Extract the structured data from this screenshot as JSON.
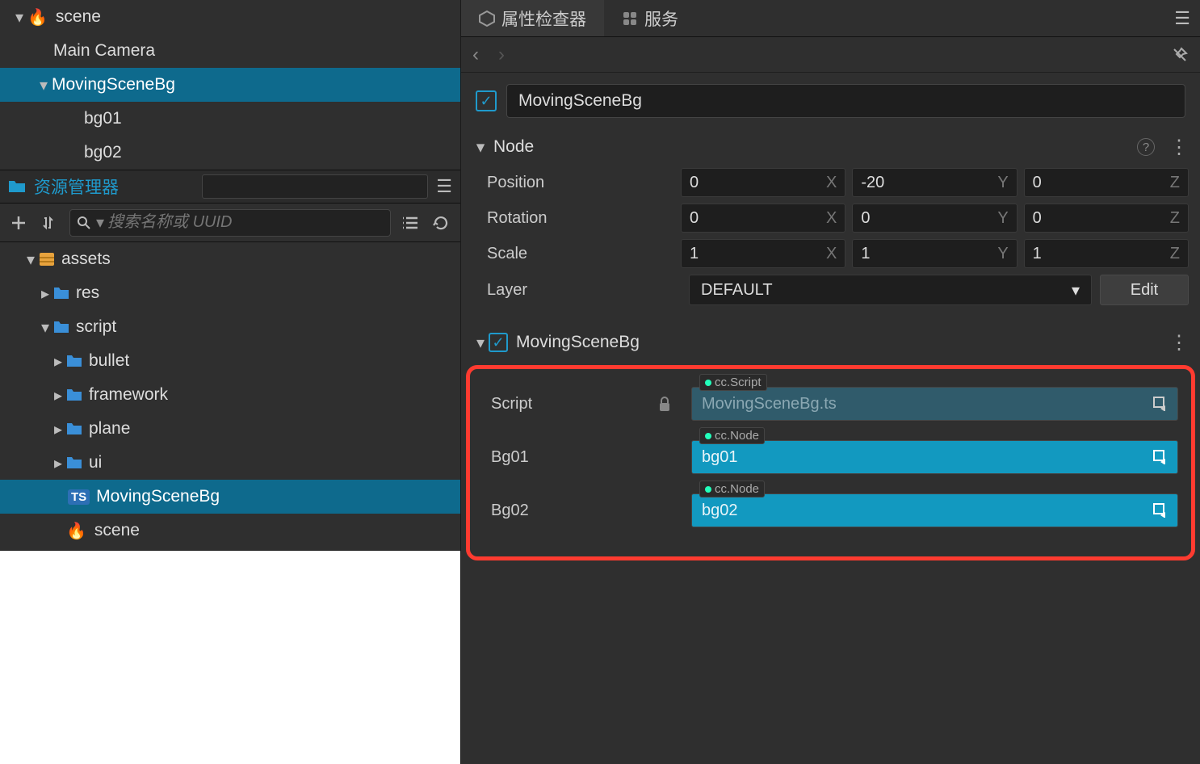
{
  "hierarchy": {
    "root": "scene",
    "items": [
      {
        "label": "Main Camera"
      },
      {
        "label": "MovingSceneBg",
        "selected": true
      },
      {
        "label": "bg01"
      },
      {
        "label": "bg02"
      }
    ]
  },
  "assets_panel": {
    "title": "资源管理器",
    "search_placeholder": "搜索名称或 UUID"
  },
  "assets_tree": {
    "root": "assets",
    "folders": [
      "res",
      "script"
    ],
    "script_subfolders": [
      "bullet",
      "framework",
      "plane",
      "ui"
    ],
    "script_file": "MovingSceneBg",
    "scene_file": "scene"
  },
  "inspector": {
    "tabs": {
      "inspector": "属性检查器",
      "services": "服务"
    },
    "node_name": "MovingSceneBg",
    "node_section": "Node",
    "position": {
      "label": "Position",
      "x": "0",
      "y": "-20",
      "z": "0"
    },
    "rotation": {
      "label": "Rotation",
      "x": "0",
      "y": "0",
      "z": "0"
    },
    "scale": {
      "label": "Scale",
      "x": "1",
      "y": "1",
      "z": "1"
    },
    "layer": {
      "label": "Layer",
      "value": "DEFAULT",
      "edit": "Edit"
    },
    "component": {
      "name": "MovingSceneBg",
      "script": {
        "label": "Script",
        "tag": "cc.Script",
        "value": "MovingSceneBg.ts"
      },
      "bg01": {
        "label": "Bg01",
        "tag": "cc.Node",
        "value": "bg01"
      },
      "bg02": {
        "label": "Bg02",
        "tag": "cc.Node",
        "value": "bg02"
      }
    }
  },
  "axis": {
    "x": "X",
    "y": "Y",
    "z": "Z"
  }
}
